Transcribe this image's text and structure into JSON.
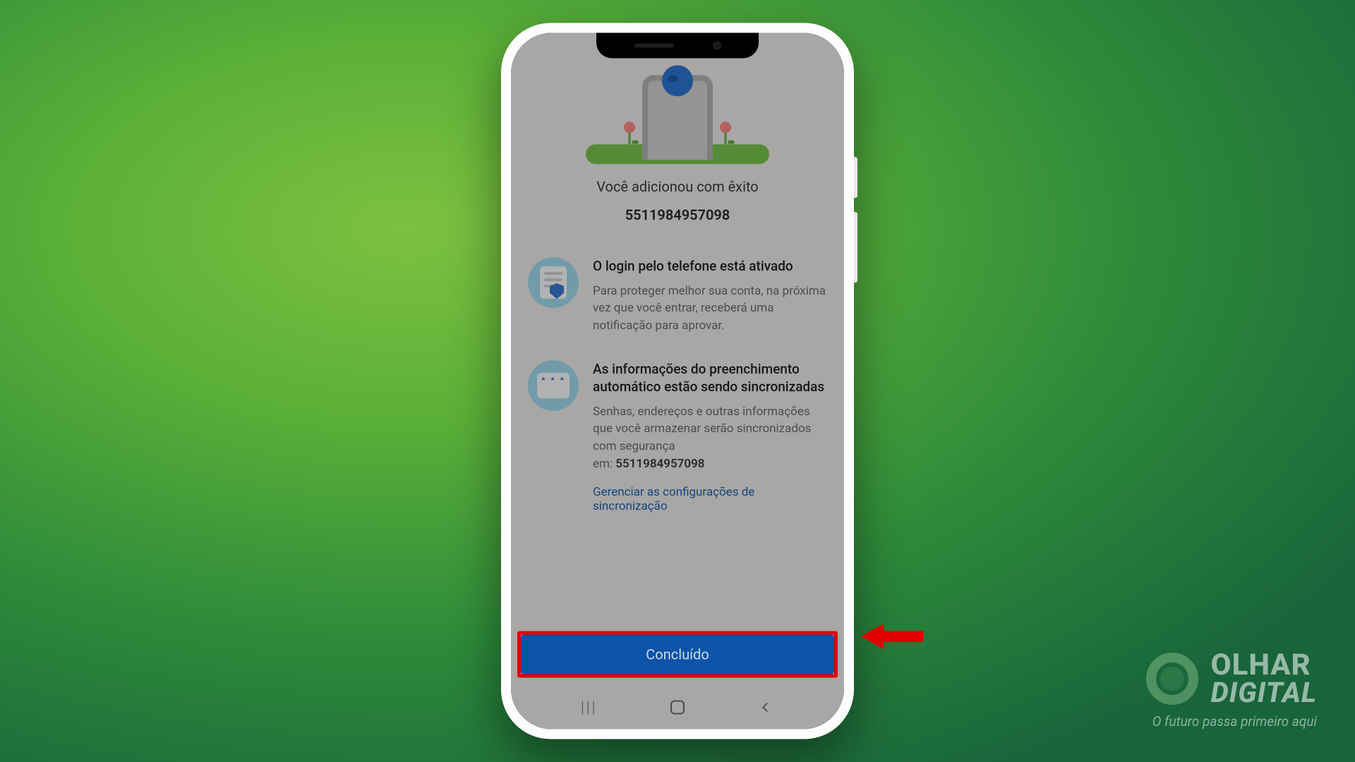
{
  "header": {
    "success_line": "Você adicionou com êxito",
    "phone_number": "5511984957098"
  },
  "features": {
    "phone_login": {
      "title": "O login pelo telefone está ativado",
      "desc_l1": "Para proteger melhor sua conta, na próxima",
      "desc_l2": "vez que você entrar, receberá uma notificação para aprovar."
    },
    "autofill_sync": {
      "title": "As informações do preenchimento automático estão sendo sincronizadas",
      "desc_main": "Senhas, endereços e outras informações que você armazenar serão sincronizados com segurança",
      "desc_prefix": "em: ",
      "desc_number": "5511984957098",
      "manage_link": "Gerenciar as configurações de sincronização"
    }
  },
  "button": {
    "done": "Concluído"
  },
  "brand": {
    "line1": "OLHAR",
    "line2": "DIGITAL",
    "tagline": "O futuro passa primeiro aqui"
  }
}
